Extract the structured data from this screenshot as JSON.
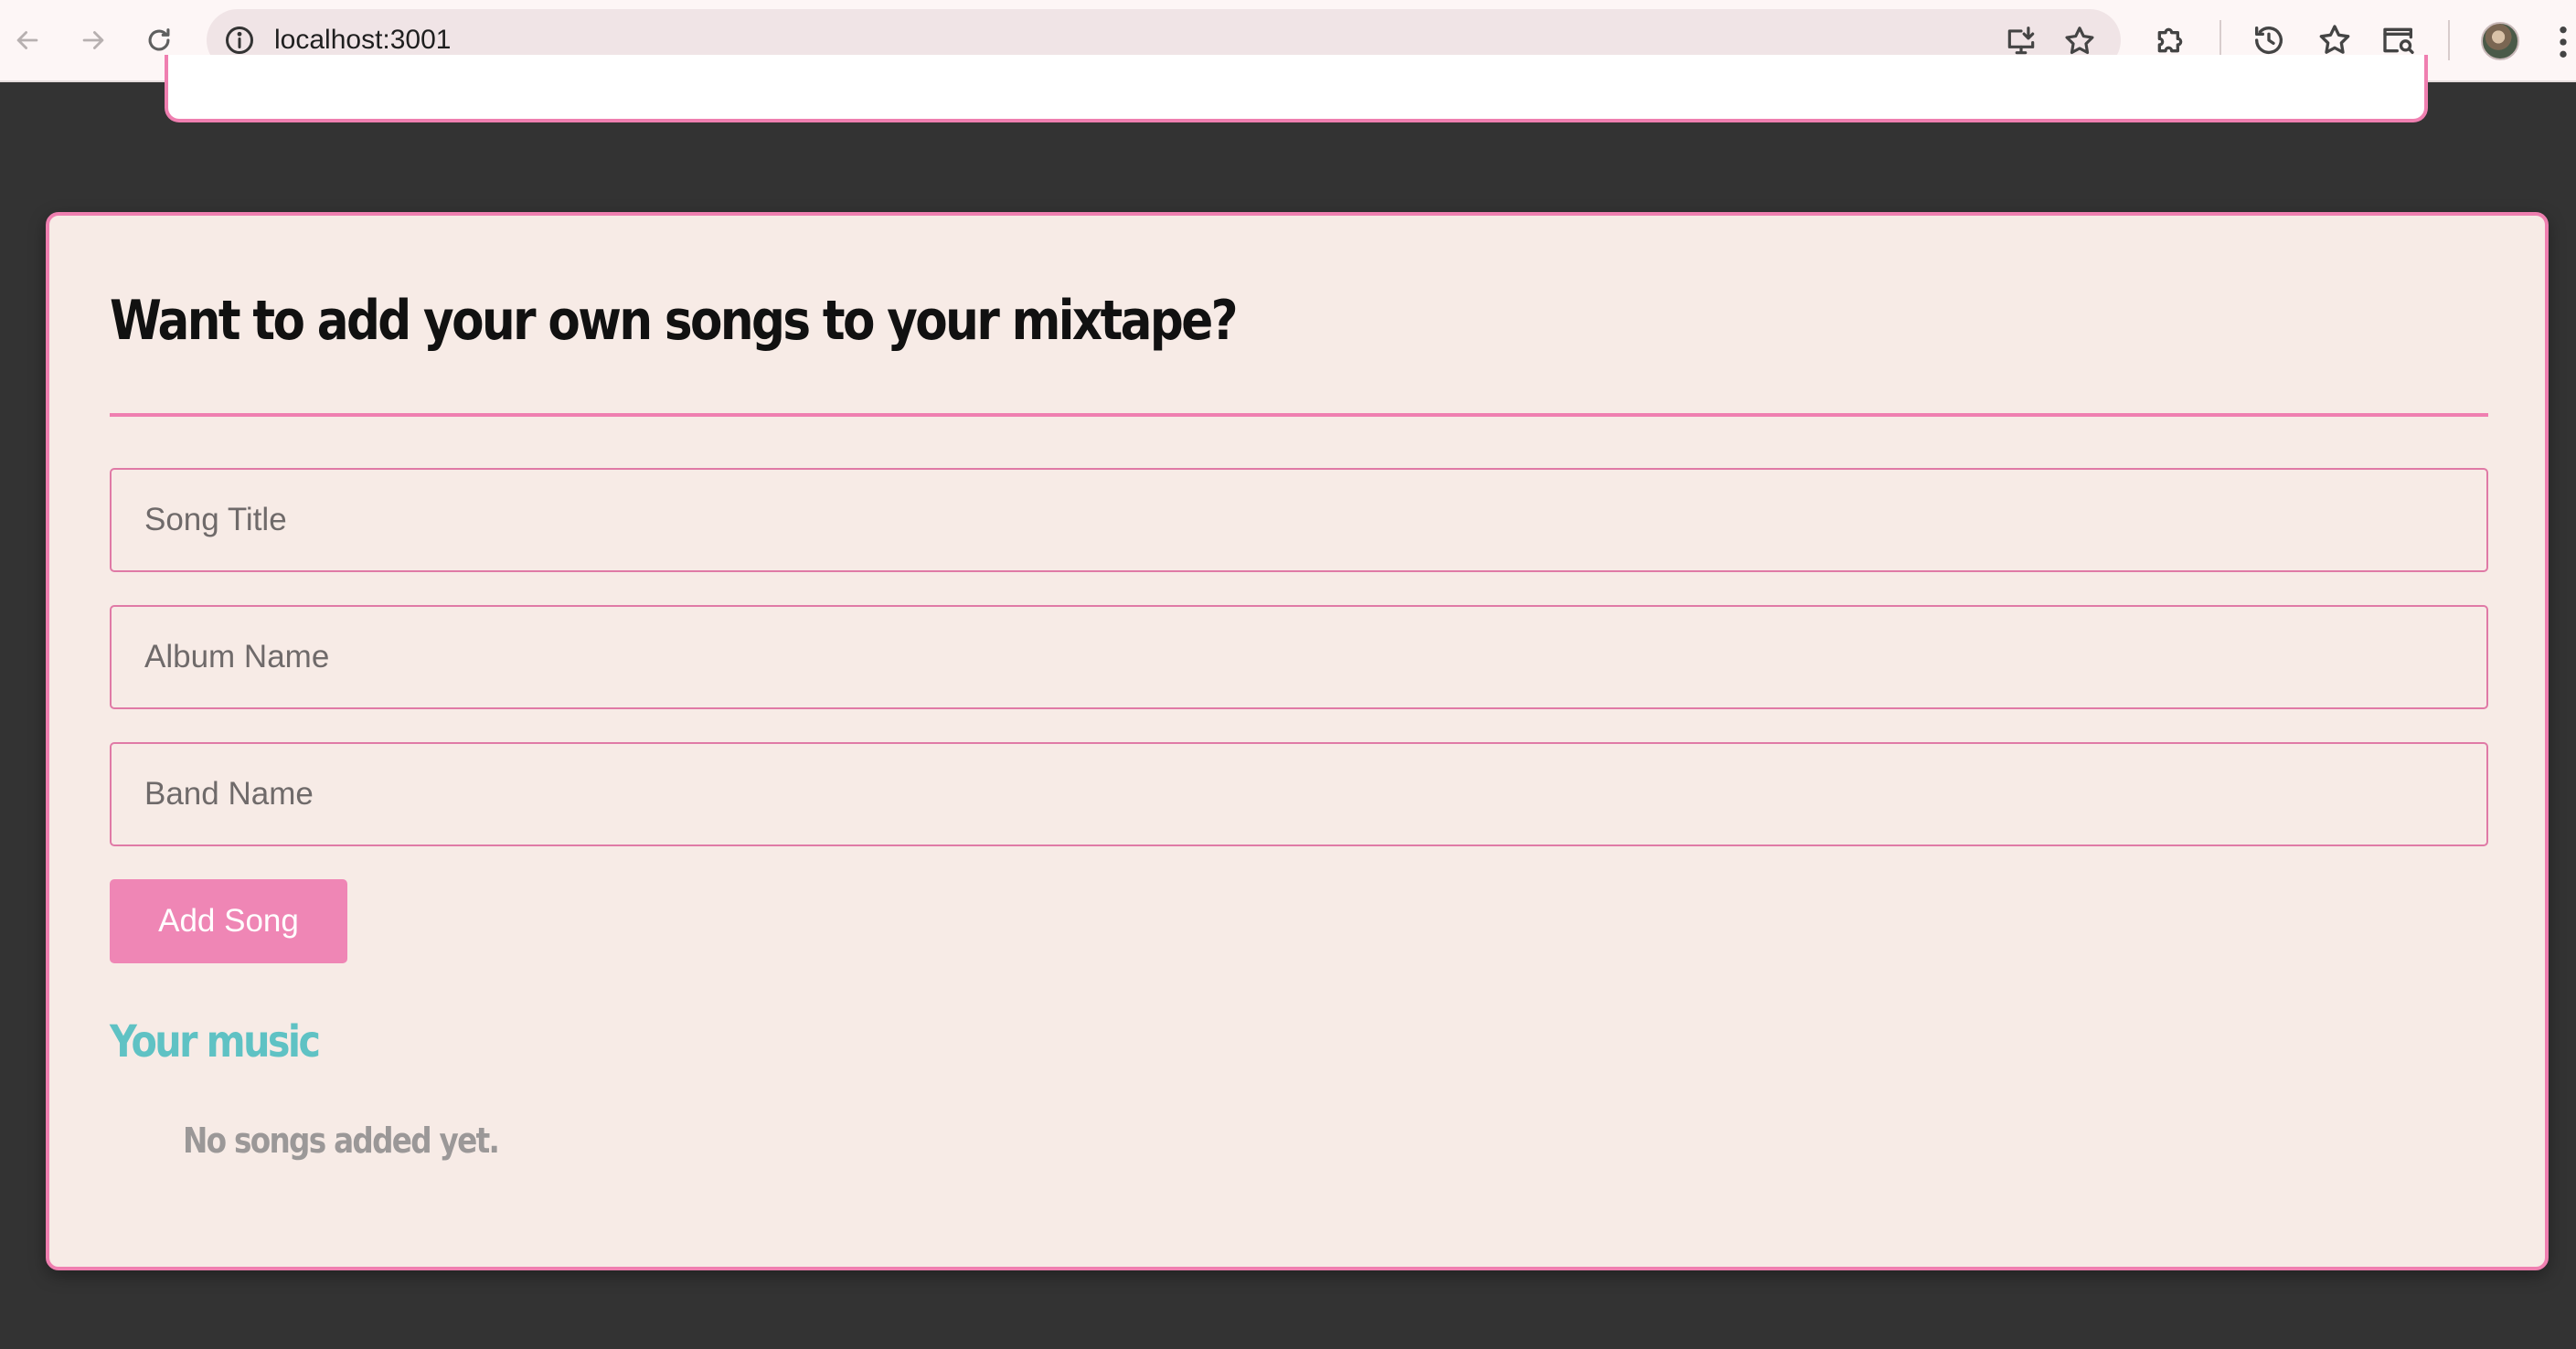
{
  "browser": {
    "url": "localhost:3001",
    "icons": {
      "back": "back-arrow-icon",
      "forward": "forward-arrow-icon",
      "reload": "reload-icon",
      "site_info": "info-icon",
      "install": "install-app-icon",
      "bookmark": "star-icon",
      "extensions": "puzzle-icon",
      "history": "history-icon",
      "bookmarks": "bookmarks-star-icon",
      "tab_search": "tab-search-icon",
      "profile": "avatar",
      "menu": "kebab-menu-icon"
    }
  },
  "form": {
    "title": "Want to add your own songs to your mixtape?",
    "song_title_placeholder": "Song Title",
    "album_name_placeholder": "Album Name",
    "band_name_placeholder": "Band Name",
    "add_button_label": "Add Song"
  },
  "music": {
    "heading": "Your music",
    "empty_message": "No songs added yet."
  },
  "colors": {
    "page_background": "#333333",
    "card_background": "#f7ebe6",
    "accent_pink": "#ef7fb0",
    "button_pink": "#ef86b5",
    "heading_teal": "#5fc2c4",
    "muted_text": "#9b9898"
  }
}
